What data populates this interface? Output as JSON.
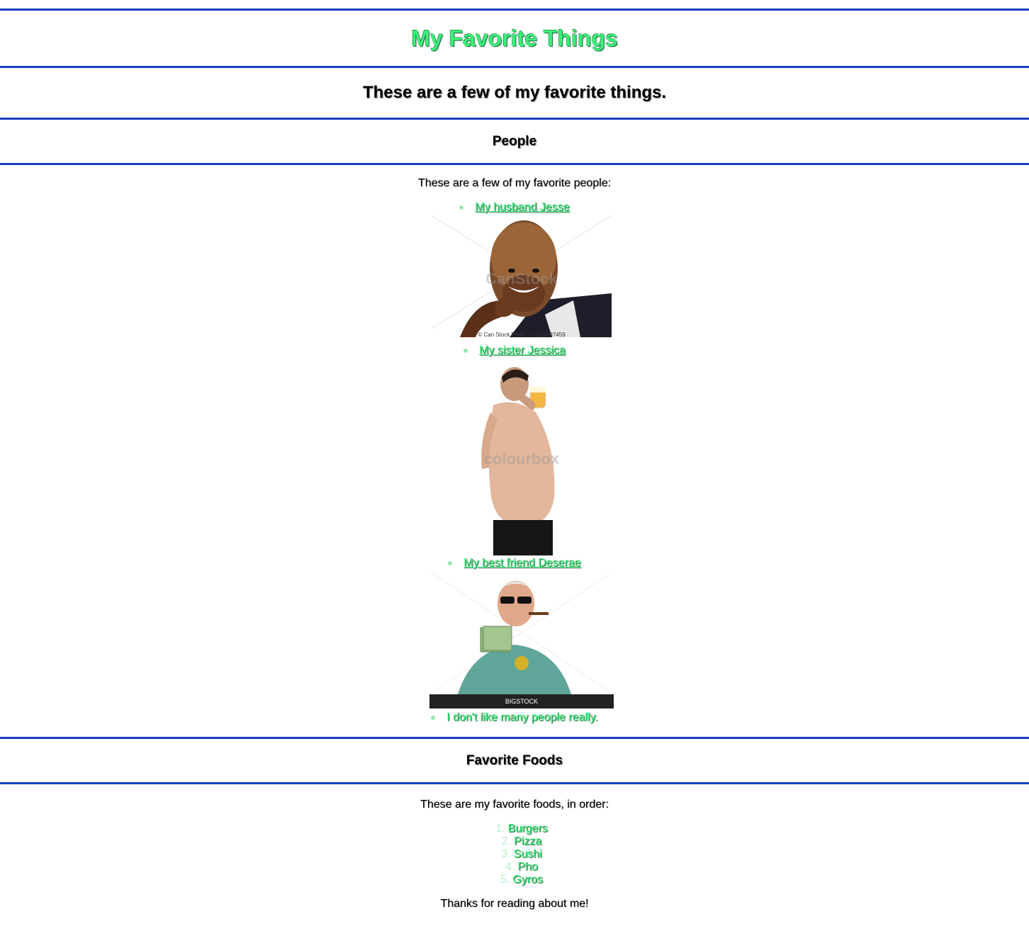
{
  "header": {
    "title": "My Favorite Things",
    "subtitle": "These are a few of my favorite things."
  },
  "people": {
    "heading": "People",
    "intro": "These are a few of my favorite people:",
    "items": [
      {
        "label": "My husband Jesse",
        "photo_caption": "© Can Stock Photo - csp16597459",
        "photo_watermark": "CanStock"
      },
      {
        "label": "My sister Jessica",
        "photo_watermark": "colourbox"
      },
      {
        "label": "My best friend Deserae",
        "photo_watermark": "BIGSTOCK",
        "photo_bar_text": "BIGSTOCK"
      },
      {
        "label": "I don't like many people really."
      }
    ]
  },
  "foods": {
    "heading": "Favorite Foods",
    "intro": "These are my favorite foods, in order:",
    "items": [
      {
        "num": "1.",
        "label": "Burgers"
      },
      {
        "num": "2.",
        "label": "Pizza"
      },
      {
        "num": "3.",
        "label": "Sushi"
      },
      {
        "num": "4.",
        "label": "Pho"
      },
      {
        "num": "5.",
        "label": "Gyros"
      }
    ],
    "outro": "Thanks for reading about me!"
  },
  "colors": {
    "accent_green": "#3cf07a",
    "rule_blue": "#1a3fbf"
  }
}
